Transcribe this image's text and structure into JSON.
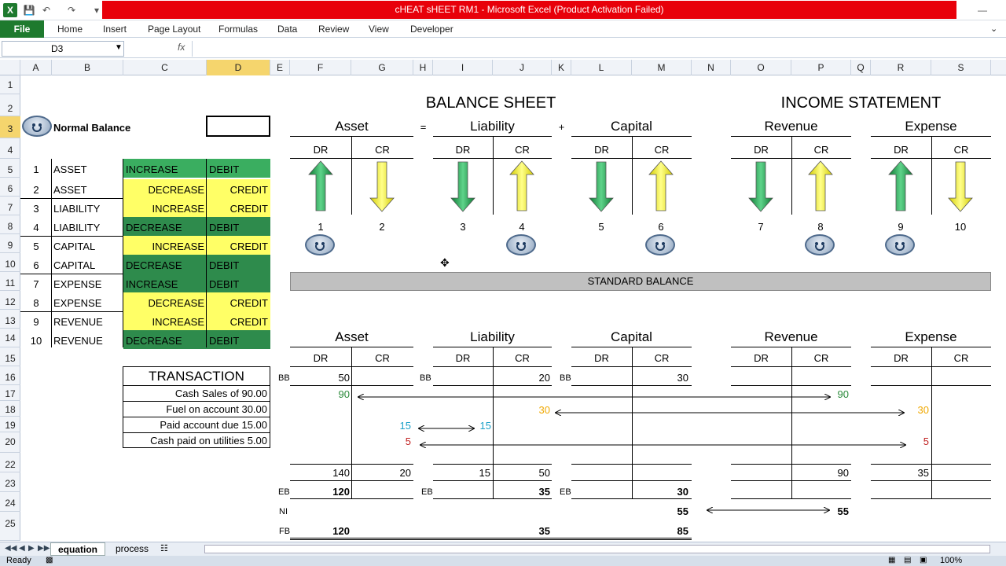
{
  "window": {
    "title": "cHEAT sHEET RM1  -  Microsoft Excel (Product Activation Failed)"
  },
  "ribbon": {
    "file": "File",
    "tabs": [
      "Home",
      "Insert",
      "Page Layout",
      "Formulas",
      "Data",
      "Review",
      "View",
      "Developer"
    ]
  },
  "formula_bar": {
    "name_box": "D3",
    "fx": "fx",
    "formula": ""
  },
  "columns": [
    "A",
    "B",
    "C",
    "D",
    "E",
    "F",
    "G",
    "H",
    "I",
    "J",
    "K",
    "L",
    "M",
    "N",
    "O",
    "P",
    "Q",
    "R",
    "S"
  ],
  "rows": [
    "1",
    "2",
    "3",
    "4",
    "5",
    "6",
    "7",
    "8",
    "9",
    "10",
    "11",
    "12",
    "13",
    "14",
    "15",
    "16",
    "17",
    "18",
    "19",
    "20",
    "22",
    "23",
    "24",
    "25"
  ],
  "normal_balance": {
    "title": "Normal Balance",
    "items": [
      {
        "n": "1",
        "acct": "ASSET",
        "dir": "INCREASE",
        "side": "DEBIT",
        "style": "g"
      },
      {
        "n": "2",
        "acct": "ASSET",
        "dir": "DECREASE",
        "side": "CREDIT",
        "style": "y"
      },
      {
        "n": "3",
        "acct": "LIABILITY",
        "dir": "INCREASE",
        "side": "CREDIT",
        "style": "y"
      },
      {
        "n": "4",
        "acct": "LIABILITY",
        "dir": "DECREASE",
        "side": "DEBIT",
        "style": "dg"
      },
      {
        "n": "5",
        "acct": "CAPITAL",
        "dir": "INCREASE",
        "side": "CREDIT",
        "style": "y"
      },
      {
        "n": "6",
        "acct": "CAPITAL",
        "dir": "DECREASE",
        "side": "DEBIT",
        "style": "dg"
      },
      {
        "n": "7",
        "acct": "EXPENSE",
        "dir": "INCREASE",
        "side": "DEBIT",
        "style": "dg"
      },
      {
        "n": "8",
        "acct": "EXPENSE",
        "dir": "DECREASE",
        "side": "CREDIT",
        "style": "y"
      },
      {
        "n": "9",
        "acct": "REVENUE",
        "dir": "INCREASE",
        "side": "CREDIT",
        "style": "y"
      },
      {
        "n": "10",
        "acct": "REVENUE",
        "dir": "DECREASE",
        "side": "DEBIT",
        "style": "dg"
      }
    ]
  },
  "transaction": {
    "title": "TRANSACTION",
    "items": [
      "Cash Sales of 90.00",
      "Fuel on account 30.00",
      "Paid account due 15.00",
      "Cash paid on utilities 5.00"
    ]
  },
  "balance_sheet": {
    "title": "BALANCE SHEET",
    "asset": "Asset",
    "liability": "Liability",
    "capital": "Capital",
    "eq": "=",
    "plus": "+"
  },
  "income_statement": {
    "title": "INCOME STATEMENT",
    "revenue": "Revenue",
    "expense": "Expense"
  },
  "dr": "DR",
  "cr": "CR",
  "arrow_numbers": [
    "1",
    "2",
    "3",
    "4",
    "5",
    "6",
    "7",
    "8",
    "9",
    "10"
  ],
  "standard_balance": "STANDARD BALANCE",
  "ledger": {
    "asset": "Asset",
    "liability": "Liability",
    "capital": "Capital",
    "revenue": "Revenue",
    "expense": "Expense",
    "bb": "BB",
    "eb": "EB",
    "ni": "NI",
    "fb": "FB",
    "asset_bb_dr": "50",
    "liab_bb_cr": "20",
    "cap_bb_cr": "30",
    "asset_dr_90": "90",
    "rev_cr_90": "90",
    "liab_cr_30": "30",
    "exp_dr_30": "30",
    "asset_cr_15": "15",
    "liab_dr_15": "15",
    "asset_cr_5": "5",
    "exp_dr_5": "5",
    "asset_tot_dr": "140",
    "asset_tot_cr": "20",
    "liab_tot_dr": "15",
    "liab_tot_cr": "50",
    "rev_tot_cr": "90",
    "exp_tot_dr": "35",
    "asset_eb": "120",
    "liab_eb": "35",
    "cap_eb": "30",
    "cap_ni": "55",
    "rev_ni": "55",
    "asset_fb": "120",
    "liab_fb": "35",
    "cap_fb": "85"
  },
  "sheets": [
    "equation",
    "process"
  ],
  "status": {
    "ready": "Ready",
    "zoom": "100%"
  },
  "colors": {
    "title_red": "#e8000a",
    "file_green": "#1e7a2e",
    "debit_green": "#3aae60",
    "dark_green": "#2e8b4c",
    "yellow": "#ffff66",
    "num_green": "#2a8a3a",
    "num_orange": "#f0a800",
    "num_cyan": "#1aa0c8",
    "num_red": "#c02020"
  }
}
